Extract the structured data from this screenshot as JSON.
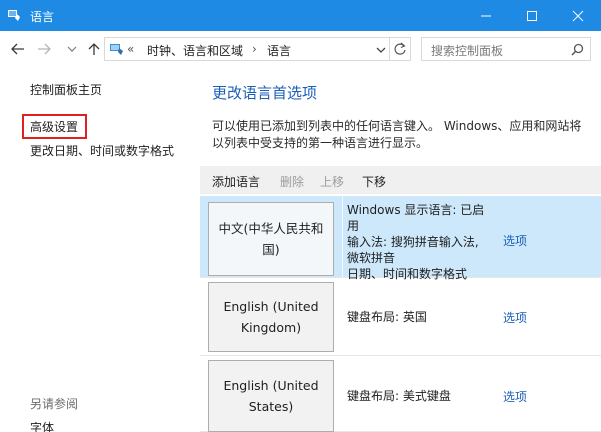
{
  "window": {
    "title": "语言",
    "titlebar_color": "#1f8ae3"
  },
  "address": {
    "more": "«",
    "crumbs": [
      "时钟、语言和区域",
      "语言"
    ],
    "separator": "›"
  },
  "search": {
    "placeholder": "搜索控制面板"
  },
  "left": {
    "home": "控制面板主页",
    "advanced": "高级设置",
    "datetime": "更改日期、时间或数字格式",
    "see_also": "另请参阅",
    "fonts": "字体",
    "highlight_color": "#e02020"
  },
  "main": {
    "heading": "更改语言首选项",
    "description": "可以使用已添加到列表中的任何语言键入。 Windows、应用和网站将以列表中受支持的第一种语言进行显示。",
    "toolbar": {
      "add": "添加语言",
      "remove": "删除",
      "up": "上移",
      "down": "下移"
    },
    "languages": [
      {
        "name": "中文(中华人民共和国)",
        "info": [
          "Windows 显示语言: 已启用",
          "输入法: 搜狗拼音输入法, 微软拼音",
          "日期、时间和数字格式"
        ],
        "option": "选项"
      },
      {
        "name": "English (United Kingdom)",
        "info": [
          "键盘布局: 英国"
        ],
        "option": "选项"
      },
      {
        "name": "English (United States)",
        "info": [
          "键盘布局: 美式键盘"
        ],
        "option": "选项"
      }
    ],
    "link_color": "#1c5fb8",
    "selected_row_color": "#cde8fb"
  }
}
